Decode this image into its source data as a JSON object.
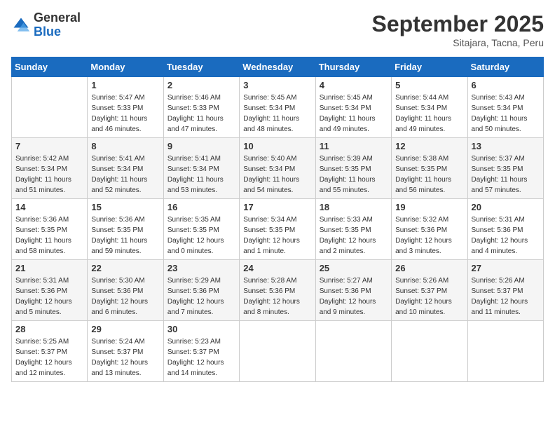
{
  "logo": {
    "general": "General",
    "blue": "Blue"
  },
  "header": {
    "month": "September 2025",
    "location": "Sitajara, Tacna, Peru"
  },
  "weekdays": [
    "Sunday",
    "Monday",
    "Tuesday",
    "Wednesday",
    "Thursday",
    "Friday",
    "Saturday"
  ],
  "weeks": [
    [
      {
        "day": "",
        "sunrise": "",
        "sunset": "",
        "daylight": ""
      },
      {
        "day": "1",
        "sunrise": "Sunrise: 5:47 AM",
        "sunset": "Sunset: 5:33 PM",
        "daylight": "Daylight: 11 hours and 46 minutes."
      },
      {
        "day": "2",
        "sunrise": "Sunrise: 5:46 AM",
        "sunset": "Sunset: 5:33 PM",
        "daylight": "Daylight: 11 hours and 47 minutes."
      },
      {
        "day": "3",
        "sunrise": "Sunrise: 5:45 AM",
        "sunset": "Sunset: 5:34 PM",
        "daylight": "Daylight: 11 hours and 48 minutes."
      },
      {
        "day": "4",
        "sunrise": "Sunrise: 5:45 AM",
        "sunset": "Sunset: 5:34 PM",
        "daylight": "Daylight: 11 hours and 49 minutes."
      },
      {
        "day": "5",
        "sunrise": "Sunrise: 5:44 AM",
        "sunset": "Sunset: 5:34 PM",
        "daylight": "Daylight: 11 hours and 49 minutes."
      },
      {
        "day": "6",
        "sunrise": "Sunrise: 5:43 AM",
        "sunset": "Sunset: 5:34 PM",
        "daylight": "Daylight: 11 hours and 50 minutes."
      }
    ],
    [
      {
        "day": "7",
        "sunrise": "Sunrise: 5:42 AM",
        "sunset": "Sunset: 5:34 PM",
        "daylight": "Daylight: 11 hours and 51 minutes."
      },
      {
        "day": "8",
        "sunrise": "Sunrise: 5:41 AM",
        "sunset": "Sunset: 5:34 PM",
        "daylight": "Daylight: 11 hours and 52 minutes."
      },
      {
        "day": "9",
        "sunrise": "Sunrise: 5:41 AM",
        "sunset": "Sunset: 5:34 PM",
        "daylight": "Daylight: 11 hours and 53 minutes."
      },
      {
        "day": "10",
        "sunrise": "Sunrise: 5:40 AM",
        "sunset": "Sunset: 5:34 PM",
        "daylight": "Daylight: 11 hours and 54 minutes."
      },
      {
        "day": "11",
        "sunrise": "Sunrise: 5:39 AM",
        "sunset": "Sunset: 5:35 PM",
        "daylight": "Daylight: 11 hours and 55 minutes."
      },
      {
        "day": "12",
        "sunrise": "Sunrise: 5:38 AM",
        "sunset": "Sunset: 5:35 PM",
        "daylight": "Daylight: 11 hours and 56 minutes."
      },
      {
        "day": "13",
        "sunrise": "Sunrise: 5:37 AM",
        "sunset": "Sunset: 5:35 PM",
        "daylight": "Daylight: 11 hours and 57 minutes."
      }
    ],
    [
      {
        "day": "14",
        "sunrise": "Sunrise: 5:36 AM",
        "sunset": "Sunset: 5:35 PM",
        "daylight": "Daylight: 11 hours and 58 minutes."
      },
      {
        "day": "15",
        "sunrise": "Sunrise: 5:36 AM",
        "sunset": "Sunset: 5:35 PM",
        "daylight": "Daylight: 11 hours and 59 minutes."
      },
      {
        "day": "16",
        "sunrise": "Sunrise: 5:35 AM",
        "sunset": "Sunset: 5:35 PM",
        "daylight": "Daylight: 12 hours and 0 minutes."
      },
      {
        "day": "17",
        "sunrise": "Sunrise: 5:34 AM",
        "sunset": "Sunset: 5:35 PM",
        "daylight": "Daylight: 12 hours and 1 minute."
      },
      {
        "day": "18",
        "sunrise": "Sunrise: 5:33 AM",
        "sunset": "Sunset: 5:35 PM",
        "daylight": "Daylight: 12 hours and 2 minutes."
      },
      {
        "day": "19",
        "sunrise": "Sunrise: 5:32 AM",
        "sunset": "Sunset: 5:36 PM",
        "daylight": "Daylight: 12 hours and 3 minutes."
      },
      {
        "day": "20",
        "sunrise": "Sunrise: 5:31 AM",
        "sunset": "Sunset: 5:36 PM",
        "daylight": "Daylight: 12 hours and 4 minutes."
      }
    ],
    [
      {
        "day": "21",
        "sunrise": "Sunrise: 5:31 AM",
        "sunset": "Sunset: 5:36 PM",
        "daylight": "Daylight: 12 hours and 5 minutes."
      },
      {
        "day": "22",
        "sunrise": "Sunrise: 5:30 AM",
        "sunset": "Sunset: 5:36 PM",
        "daylight": "Daylight: 12 hours and 6 minutes."
      },
      {
        "day": "23",
        "sunrise": "Sunrise: 5:29 AM",
        "sunset": "Sunset: 5:36 PM",
        "daylight": "Daylight: 12 hours and 7 minutes."
      },
      {
        "day": "24",
        "sunrise": "Sunrise: 5:28 AM",
        "sunset": "Sunset: 5:36 PM",
        "daylight": "Daylight: 12 hours and 8 minutes."
      },
      {
        "day": "25",
        "sunrise": "Sunrise: 5:27 AM",
        "sunset": "Sunset: 5:36 PM",
        "daylight": "Daylight: 12 hours and 9 minutes."
      },
      {
        "day": "26",
        "sunrise": "Sunrise: 5:26 AM",
        "sunset": "Sunset: 5:37 PM",
        "daylight": "Daylight: 12 hours and 10 minutes."
      },
      {
        "day": "27",
        "sunrise": "Sunrise: 5:26 AM",
        "sunset": "Sunset: 5:37 PM",
        "daylight": "Daylight: 12 hours and 11 minutes."
      }
    ],
    [
      {
        "day": "28",
        "sunrise": "Sunrise: 5:25 AM",
        "sunset": "Sunset: 5:37 PM",
        "daylight": "Daylight: 12 hours and 12 minutes."
      },
      {
        "day": "29",
        "sunrise": "Sunrise: 5:24 AM",
        "sunset": "Sunset: 5:37 PM",
        "daylight": "Daylight: 12 hours and 13 minutes."
      },
      {
        "day": "30",
        "sunrise": "Sunrise: 5:23 AM",
        "sunset": "Sunset: 5:37 PM",
        "daylight": "Daylight: 12 hours and 14 minutes."
      },
      {
        "day": "",
        "sunrise": "",
        "sunset": "",
        "daylight": ""
      },
      {
        "day": "",
        "sunrise": "",
        "sunset": "",
        "daylight": ""
      },
      {
        "day": "",
        "sunrise": "",
        "sunset": "",
        "daylight": ""
      },
      {
        "day": "",
        "sunrise": "",
        "sunset": "",
        "daylight": ""
      }
    ]
  ]
}
